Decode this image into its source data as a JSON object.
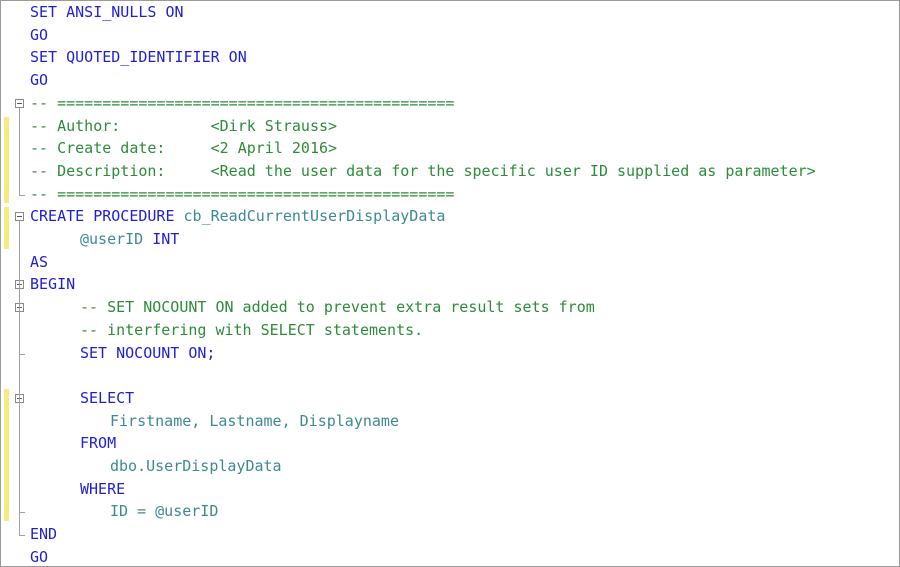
{
  "colors": {
    "keyword": "#1f1fd6",
    "comment": "#2e8b3a",
    "identifier": "#1a1a1a",
    "change_marker": "#f4ec7e"
  },
  "lines": [
    {
      "indent": 0,
      "tokens": [
        {
          "t": "SET ANSI_NULLS ON",
          "k": "kw"
        }
      ]
    },
    {
      "indent": 0,
      "tokens": [
        {
          "t": "GO",
          "k": "kw"
        }
      ]
    },
    {
      "indent": 0,
      "tokens": [
        {
          "t": "SET QUOTED_IDENTIFIER ON",
          "k": "kw"
        }
      ]
    },
    {
      "indent": 0,
      "tokens": [
        {
          "t": "GO",
          "k": "kw"
        }
      ]
    },
    {
      "indent": 0,
      "tokens": [
        {
          "t": "-- ============================================",
          "k": "cm"
        }
      ]
    },
    {
      "indent": 0,
      "tokens": [
        {
          "t": "-- Author:          <Dirk Strauss>",
          "k": "cm"
        }
      ]
    },
    {
      "indent": 0,
      "tokens": [
        {
          "t": "-- Create date:     <2 April 2016>",
          "k": "cm"
        }
      ]
    },
    {
      "indent": 0,
      "tokens": [
        {
          "t": "-- Description:     <Read the user data for the specific user ID supplied as parameter>",
          "k": "cm"
        }
      ]
    },
    {
      "indent": 0,
      "tokens": [
        {
          "t": "-- ============================================",
          "k": "cm"
        }
      ]
    },
    {
      "indent": 0,
      "tokens": [
        {
          "t": "CREATE PROCEDURE ",
          "k": "kw"
        },
        {
          "t": "cb_ReadCurrentUserDisplayData",
          "k": "pl"
        }
      ]
    },
    {
      "indent": 1,
      "tokens": [
        {
          "t": "@userID ",
          "k": "pl"
        },
        {
          "t": "INT",
          "k": "kw"
        }
      ]
    },
    {
      "indent": 0,
      "tokens": [
        {
          "t": "AS",
          "k": "kw"
        }
      ]
    },
    {
      "indent": 0,
      "tokens": [
        {
          "t": "BEGIN",
          "k": "kw"
        }
      ]
    },
    {
      "indent": 1,
      "tokens": [
        {
          "t": "-- SET NOCOUNT ON added to prevent extra result sets from",
          "k": "cm"
        }
      ]
    },
    {
      "indent": 1,
      "tokens": [
        {
          "t": "-- interfering with SELECT statements.",
          "k": "cm"
        }
      ]
    },
    {
      "indent": 1,
      "tokens": [
        {
          "t": "SET NOCOUNT ON;",
          "k": "kw"
        }
      ]
    },
    {
      "indent": 1,
      "tokens": []
    },
    {
      "indent": 1,
      "tokens": [
        {
          "t": "SELECT",
          "k": "kw"
        }
      ]
    },
    {
      "indent": 2,
      "tokens": [
        {
          "t": "Firstname, Lastname, Displayname",
          "k": "pl"
        }
      ]
    },
    {
      "indent": 1,
      "tokens": [
        {
          "t": "FROM",
          "k": "kw"
        }
      ]
    },
    {
      "indent": 2,
      "tokens": [
        {
          "t": "dbo.UserDisplayData",
          "k": "pl"
        }
      ]
    },
    {
      "indent": 1,
      "tokens": [
        {
          "t": "WHERE",
          "k": "kw"
        }
      ]
    },
    {
      "indent": 2,
      "tokens": [
        {
          "t": "ID = @userID",
          "k": "pl"
        }
      ]
    },
    {
      "indent": 0,
      "tokens": [
        {
          "t": "END",
          "k": "kw"
        }
      ]
    },
    {
      "indent": 0,
      "tokens": [
        {
          "t": "GO",
          "k": "kw"
        }
      ]
    }
  ]
}
